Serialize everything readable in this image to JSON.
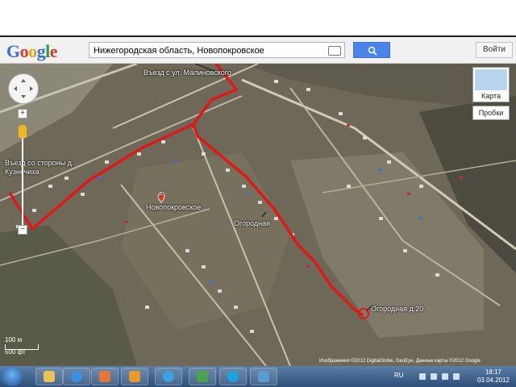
{
  "browser": {
    "logo_letters": [
      "G",
      "o",
      "o",
      "g",
      "l",
      "e"
    ]
  },
  "search": {
    "value": "Нижегородская область, Новопокровское",
    "button_icon": "search-icon"
  },
  "header": {
    "login_label": "Войти"
  },
  "map_controls": {
    "zoom_in": "+",
    "zoom_out": "−",
    "map_type_label": "Карта",
    "traffic_label": "Пробки"
  },
  "annotations": {
    "entry_north": "Въезд с ул. Малиновского",
    "entry_west": "Въезд со стороны д. Кузнечиха",
    "street": "Огородная",
    "destination": "Огородная д.20",
    "place_marker": "A",
    "place_name": "Новопокровское"
  },
  "scale": {
    "metric": "100 м",
    "imperial": "500 фт"
  },
  "attribution": "Изображения ©2012 DigitalGlobe, GeoEye, Данные карты ©2012 Google",
  "taskbar": {
    "language": "RU",
    "time": "18:17",
    "date": "03.04.2012",
    "apps": [
      "explorer-icon",
      "ie-icon",
      "media-player-icon",
      "outlook-icon",
      "ie-icon",
      "lync-icon",
      "skype-icon",
      "photo-viewer-icon"
    ]
  },
  "colors": {
    "route": "#e01818",
    "search_button": "#4a84e8",
    "taskbar": "#2d4f78"
  }
}
